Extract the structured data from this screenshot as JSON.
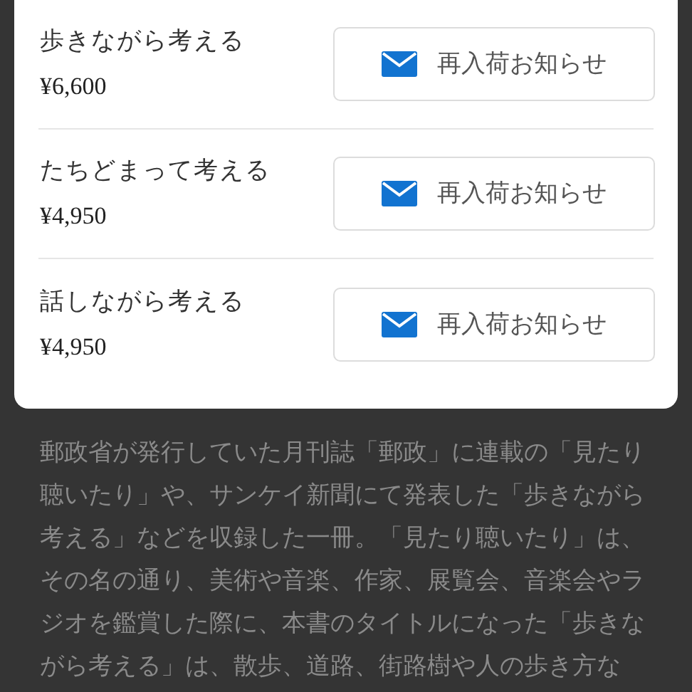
{
  "items": [
    {
      "title": "歩きながら考える",
      "price": "¥6,600",
      "button": "再入荷お知らせ"
    },
    {
      "title": "たちどまって考える",
      "price": "¥4,950",
      "button": "再入荷お知らせ"
    },
    {
      "title": "話しながら考える",
      "price": "¥4,950",
      "button": "再入荷お知らせ"
    }
  ],
  "description": "郵政省が発行していた月刊誌「郵政」に連載の「見たり聴いたり」や、サンケイ新聞にて発表した「歩きながら考える」などを収録した一冊。「見たり聴いたり」は、その名の通り、美術や音楽、作家、展覧会、音楽会やラジオを鑑賞した際に、本書のタイトルになった「歩きながら考える」は、散歩、道路、街路樹や人の歩き方な"
}
